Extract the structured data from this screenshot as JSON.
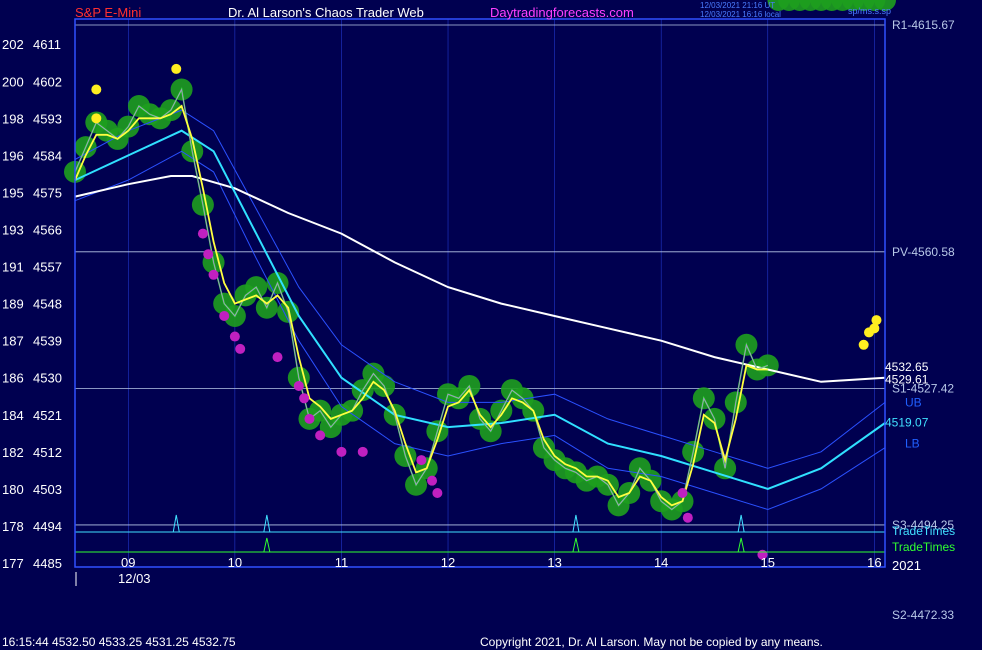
{
  "header": {
    "symbol": "S&P E-Mini",
    "author": "Dr. Al Larson's Chaos Trader Web",
    "site": "Daytradingforecasts.com",
    "timestamp_utc": "12/03/2021 21:16 UT",
    "timestamp_local": "12/03/2021 16:16 local",
    "tag": "sp/ms.s.sp",
    "colors": {
      "symbol": "#ff3030",
      "author": "#ffffff",
      "site": "#ff40ff",
      "stamp": "#4a7cff"
    }
  },
  "footer": {
    "quote": "16:15:44  4532.50 4533.25 4531.25 4532.75",
    "copyright": "Copyright 2021, Dr. Al Larson. May not be copied by any means."
  },
  "chart_data": {
    "type": "line",
    "price_range": [
      4485,
      4615.67
    ],
    "y_ticks": [
      {
        "price": 4611,
        "label": "4611",
        "left": "202"
      },
      {
        "price": 4602,
        "label": "4602",
        "left": "200"
      },
      {
        "price": 4593,
        "label": "4593",
        "left": "198"
      },
      {
        "price": 4584,
        "label": "4584",
        "left": "196"
      },
      {
        "price": 4575,
        "label": "4575",
        "left": "195"
      },
      {
        "price": 4566,
        "label": "4566",
        "left": "193"
      },
      {
        "price": 4557,
        "label": "4557",
        "left": "191"
      },
      {
        "price": 4548,
        "label": "4548",
        "left": "189"
      },
      {
        "price": 4539,
        "label": "4539",
        "left": "187"
      },
      {
        "price": 4530,
        "label": "4530",
        "left": "186"
      },
      {
        "price": 4521,
        "label": "4521",
        "left": "184"
      },
      {
        "price": 4512,
        "label": "4512",
        "left": "182"
      },
      {
        "price": 4503,
        "label": "4503",
        "left": "180"
      },
      {
        "price": 4494,
        "label": "4494",
        "left": "178"
      },
      {
        "price": 4485,
        "label": "4485",
        "left": "177"
      }
    ],
    "x_range": [
      8.5,
      16.1
    ],
    "x_ticks": [
      {
        "hour": 9,
        "label": "09"
      },
      {
        "hour": 10,
        "label": "10"
      },
      {
        "hour": 11,
        "label": "11"
      },
      {
        "hour": 12,
        "label": "12"
      },
      {
        "hour": 13,
        "label": "13"
      },
      {
        "hour": 14,
        "label": "14"
      },
      {
        "hour": 15,
        "label": "15"
      },
      {
        "hour": 16,
        "label": "16"
      }
    ],
    "date_label": "12/03",
    "year_label": "2021",
    "levels": [
      {
        "name": "R1",
        "label": "R1-4615.67",
        "price": 4615.67,
        "color": "#b8c8e8"
      },
      {
        "name": "PV",
        "label": "PV-4560.58",
        "price": 4560.58,
        "color": "#b8c8e8"
      },
      {
        "name": "S1",
        "label": "S1-4527.42",
        "price": 4527.42,
        "color": "#b8c8e8"
      },
      {
        "name": "S3",
        "label": "S3-4494.25",
        "price": 4494.25,
        "color": "#b8c8e8"
      },
      {
        "name": "S2",
        "label": "S2-4472.33",
        "price": 4472.33,
        "color": "#b8c8e8"
      }
    ],
    "end_labels": [
      {
        "label": "4532.65",
        "price": 4532.65,
        "color": "#ffffff"
      },
      {
        "label": "4529.61",
        "price": 4529.61,
        "color": "#ffffff"
      },
      {
        "label": "4519.07",
        "price": 4519.07,
        "color": "#40e0ff"
      },
      {
        "label": "UB",
        "price": 4524,
        "color": "#2060ff"
      },
      {
        "label": "LB",
        "price": 4514,
        "color": "#2060ff"
      }
    ],
    "trade_times_labels": [
      "TradeTimes",
      "TradeTimes"
    ],
    "trade_time_spikes_blue": [
      9.45,
      10.3,
      13.2,
      14.75
    ],
    "trade_time_spikes_green": [
      10.3,
      13.2,
      14.75
    ],
    "price": {
      "x": [
        8.5,
        8.6,
        8.7,
        8.8,
        8.9,
        9.0,
        9.1,
        9.2,
        9.3,
        9.4,
        9.5,
        9.6,
        9.7,
        9.8,
        9.9,
        10.0,
        10.1,
        10.2,
        10.3,
        10.4,
        10.5,
        10.6,
        10.7,
        10.8,
        10.9,
        11.0,
        11.1,
        11.2,
        11.3,
        11.4,
        11.5,
        11.6,
        11.7,
        11.8,
        11.9,
        12.0,
        12.1,
        12.2,
        12.3,
        12.4,
        12.5,
        12.6,
        12.7,
        12.8,
        12.9,
        13.0,
        13.1,
        13.2,
        13.3,
        13.4,
        13.5,
        13.6,
        13.7,
        13.8,
        13.9,
        14.0,
        14.1,
        14.2,
        14.3,
        14.4,
        14.5,
        14.6,
        14.7,
        14.8,
        14.9,
        15.0,
        15.1,
        15.2,
        15.3,
        15.4,
        15.5,
        15.6,
        15.7,
        15.8,
        15.9,
        16.0,
        16.1
      ],
      "y": [
        4580,
        4586,
        4592,
        4590,
        4588,
        4591,
        4596,
        4594,
        4593,
        4595,
        4600,
        4585,
        4572,
        4558,
        4548,
        4545,
        4550,
        4552,
        4547,
        4553,
        4546,
        4530,
        4520,
        4522,
        4518,
        4521,
        4522,
        4527,
        4531,
        4528,
        4521,
        4511,
        4504,
        4508,
        4517,
        4526,
        4525,
        4528,
        4520,
        4517,
        4522,
        4527,
        4525,
        4522,
        4513,
        4510,
        4508,
        4507,
        4505,
        4506,
        4504,
        4499,
        4502,
        4508,
        4505,
        4500,
        4498,
        4500,
        4512,
        4525,
        4520,
        4508,
        4524,
        4538,
        4532,
        4533
      ]
    },
    "ma_yellow": {
      "x": [
        8.5,
        8.6,
        8.7,
        8.8,
        8.9,
        9.0,
        9.1,
        9.2,
        9.3,
        9.4,
        9.5,
        9.6,
        9.7,
        9.8,
        9.9,
        10.0,
        10.1,
        10.2,
        10.3,
        10.4,
        10.5,
        10.6,
        10.7,
        10.8,
        10.9,
        11.0,
        11.1,
        11.2,
        11.3,
        11.4,
        11.5,
        11.6,
        11.7,
        11.8,
        11.9,
        12.0,
        12.1,
        12.2,
        12.3,
        12.4,
        12.5,
        12.6,
        12.7,
        12.8,
        12.9,
        13.0,
        13.1,
        13.2,
        13.3,
        13.4,
        13.5,
        13.6,
        13.7,
        13.8,
        13.9,
        14.0,
        14.1,
        14.2,
        14.3,
        14.4,
        14.5,
        14.6,
        14.7,
        14.8,
        14.9,
        15.0,
        15.1,
        15.2,
        15.3,
        15.4,
        15.5,
        15.6,
        15.7,
        15.8,
        15.9,
        16.0,
        16.1
      ],
      "y": [
        4578,
        4584,
        4589,
        4589,
        4588,
        4590,
        4593,
        4593,
        4593,
        4594,
        4596,
        4588,
        4576,
        4563,
        4553,
        4548,
        4549,
        4550,
        4548,
        4550,
        4547,
        4535,
        4525,
        4523,
        4520,
        4521,
        4522,
        4525,
        4529,
        4527,
        4522,
        4514,
        4507,
        4508,
        4515,
        4523,
        4524,
        4527,
        4521,
        4518,
        4521,
        4525,
        4524,
        4522,
        4515,
        4511,
        4509,
        4508,
        4506,
        4506,
        4505,
        4501,
        4502,
        4506,
        4505,
        4501,
        4499,
        4500,
        4509,
        4521,
        4519,
        4510,
        4520,
        4533,
        4532,
        4532
      ]
    },
    "ma_cyan": {
      "x": [
        8.5,
        9.0,
        9.5,
        9.8,
        10.2,
        10.6,
        11.0,
        11.5,
        12.0,
        12.5,
        13.0,
        13.5,
        14.0,
        14.5,
        15.0,
        15.5,
        16.1
      ],
      "y": [
        4578,
        4584,
        4590,
        4585,
        4565,
        4545,
        4530,
        4521,
        4518,
        4519,
        4521,
        4514,
        4511,
        4507,
        4503,
        4508,
        4519
      ]
    },
    "ma_white": {
      "x": [
        8.5,
        9.0,
        9.4,
        9.6,
        10.0,
        10.5,
        11.0,
        11.5,
        12.0,
        12.5,
        13.0,
        13.5,
        14.0,
        14.5,
        15.0,
        15.5,
        16.1
      ],
      "y": [
        4574,
        4577,
        4579,
        4579,
        4576,
        4570,
        4565,
        4558,
        4552,
        4548,
        4545,
        4542,
        4539,
        4535,
        4532,
        4529,
        4530
      ]
    },
    "band_upper": {
      "x": [
        8.5,
        9.0,
        9.5,
        9.8,
        10.2,
        10.6,
        11.0,
        11.5,
        12.0,
        12.5,
        13.0,
        13.5,
        14.0,
        14.5,
        15.0,
        15.5,
        16.1
      ],
      "y": [
        4583,
        4590,
        4595,
        4590,
        4571,
        4552,
        4538,
        4529,
        4524,
        4524,
        4526,
        4520,
        4516,
        4512,
        4508,
        4512,
        4524
      ]
    },
    "band_lower": {
      "x": [
        8.5,
        9.0,
        9.5,
        9.8,
        10.2,
        10.6,
        11.0,
        11.5,
        12.0,
        12.5,
        13.0,
        13.5,
        14.0,
        14.5,
        15.0,
        15.5,
        16.1
      ],
      "y": [
        4573,
        4578,
        4585,
        4580,
        4559,
        4539,
        4523,
        4514,
        4511,
        4514,
        4516,
        4508,
        4506,
        4502,
        4498,
        4503,
        4513
      ]
    },
    "magenta_dots": [
      [
        9.7,
        4565
      ],
      [
        9.75,
        4560
      ],
      [
        9.8,
        4555
      ],
      [
        9.9,
        4545
      ],
      [
        10.0,
        4540
      ],
      [
        10.05,
        4537
      ],
      [
        10.4,
        4535
      ],
      [
        10.6,
        4528
      ],
      [
        10.65,
        4525
      ],
      [
        10.7,
        4520
      ],
      [
        10.8,
        4516
      ],
      [
        11.0,
        4512
      ],
      [
        11.2,
        4512
      ],
      [
        11.75,
        4510
      ],
      [
        11.85,
        4505
      ],
      [
        11.9,
        4502
      ],
      [
        14.2,
        4502
      ],
      [
        14.25,
        4496
      ],
      [
        14.95,
        4487
      ]
    ],
    "yellow_dots": [
      [
        8.7,
        4600
      ],
      [
        8.7,
        4593
      ],
      [
        9.45,
        4605
      ],
      [
        15.9,
        4538
      ],
      [
        15.95,
        4541
      ],
      [
        16.0,
        4542
      ],
      [
        16.02,
        4544
      ]
    ],
    "colors": {
      "price": "#30ff30",
      "halo": "#1e9e1e",
      "ma_yellow": "#ffff40",
      "ma_cyan": "#30e0ff",
      "ma_white": "#ffffff",
      "band": "#2a50ff",
      "magenta": "#c020c0",
      "yellow_dot": "#ffee20",
      "frame": "#3050ff",
      "grid": "#3050ff"
    }
  }
}
